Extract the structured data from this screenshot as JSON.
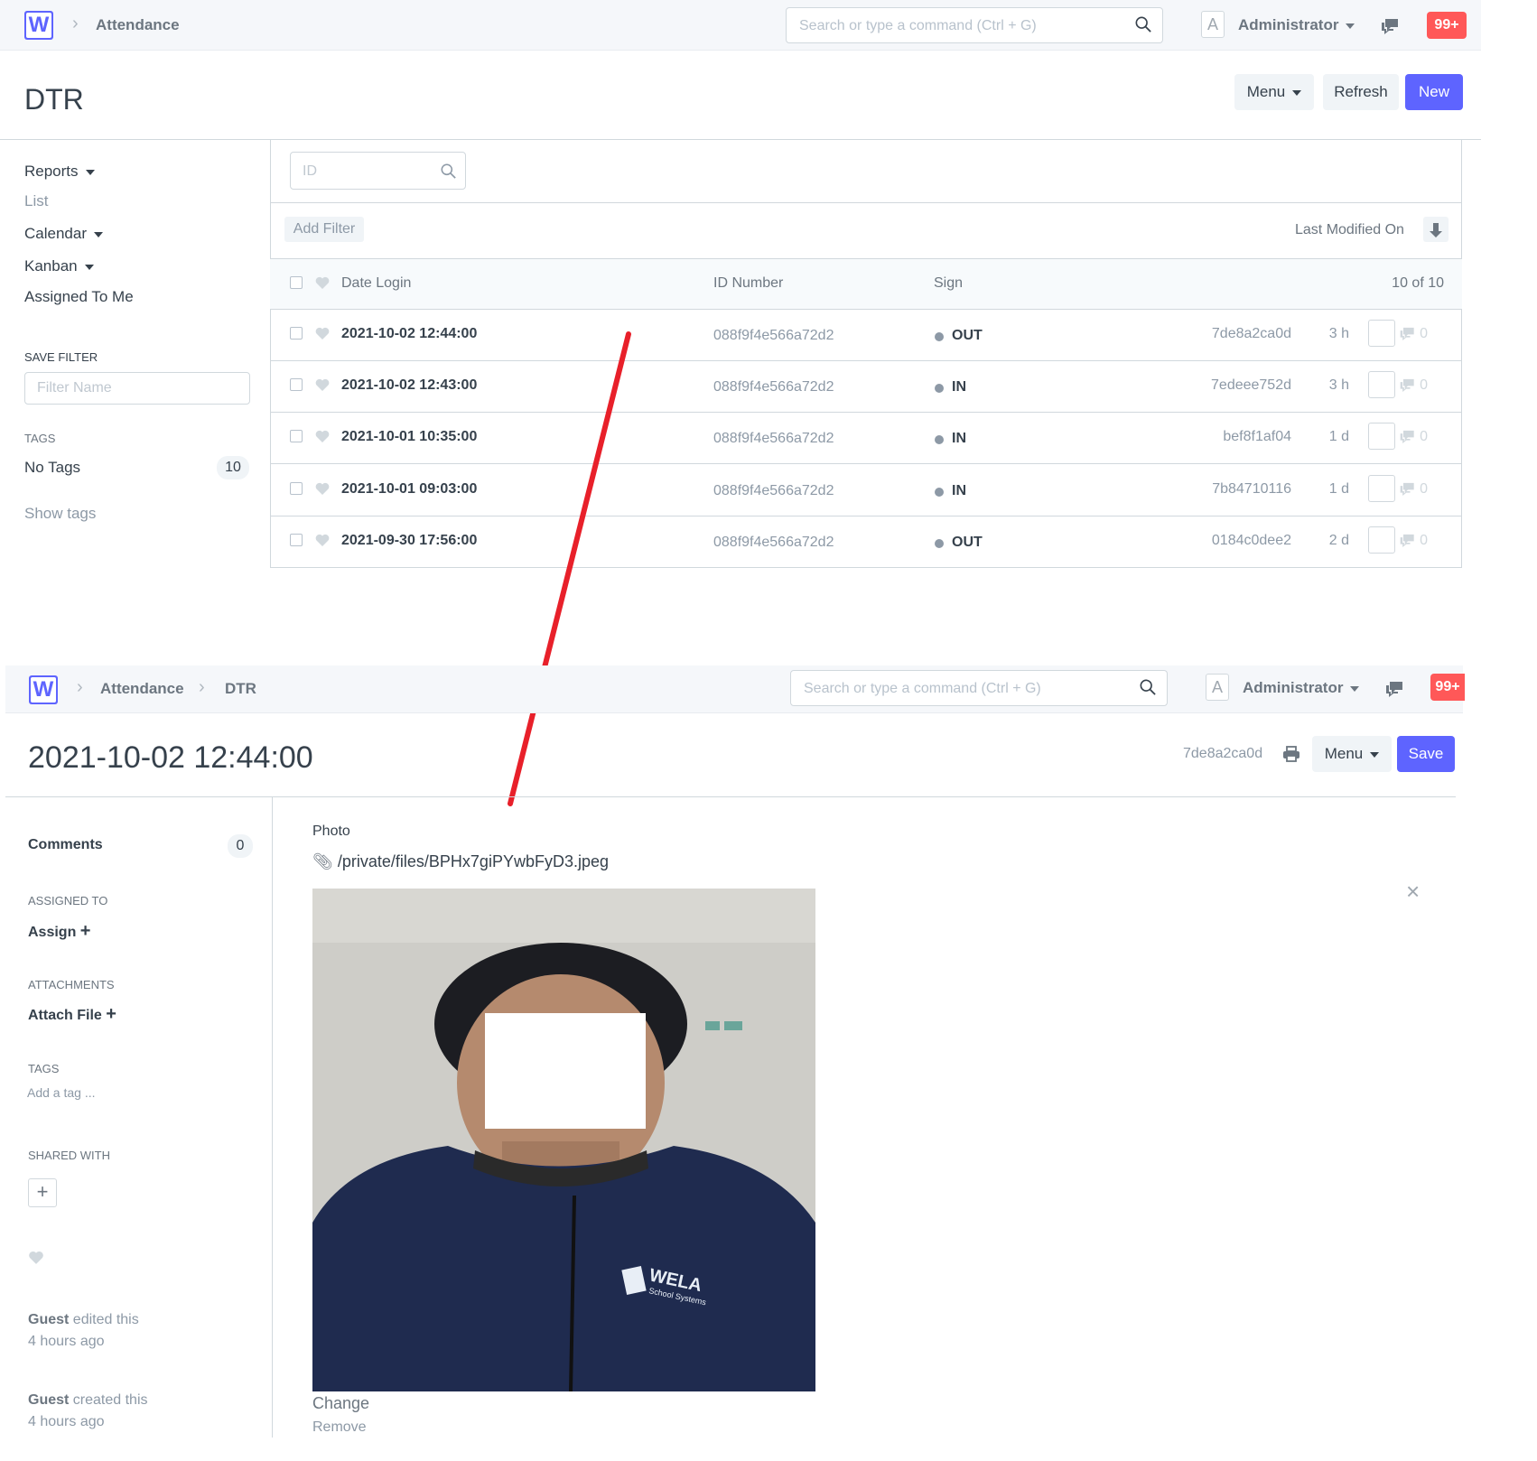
{
  "top": {
    "logo_letter": "W",
    "breadcrumbs": [
      "Attendance"
    ],
    "search_placeholder": "Search or type a command (Ctrl + G)",
    "avatar_letter": "A",
    "user": "Administrator",
    "notif_badge": "99+",
    "page_title": "DTR",
    "buttons": {
      "menu": "Menu",
      "refresh": "Refresh",
      "new": "New"
    },
    "sidebar": {
      "items": [
        "Reports",
        "List",
        "Calendar",
        "Kanban",
        "Assigned To Me"
      ],
      "save_filter_label": "SAVE FILTER",
      "filter_name_placeholder": "Filter Name",
      "tags_label": "TAGS",
      "no_tags": "No Tags",
      "no_tags_count": "10",
      "show_tags": "Show tags"
    },
    "list": {
      "id_placeholder": "ID",
      "add_filter": "Add Filter",
      "sort_label": "Last Modified On",
      "columns": [
        "Date Login",
        "ID Number",
        "Sign"
      ],
      "count": "10 of 10",
      "rows": [
        {
          "date": "2021-10-02 12:44:00",
          "id_number": "088f9f4e566a72d2",
          "sign": "OUT",
          "name": "7de8a2ca0d",
          "age": "3 h",
          "comments": "0"
        },
        {
          "date": "2021-10-02 12:43:00",
          "id_number": "088f9f4e566a72d2",
          "sign": "IN",
          "name": "7edeee752d",
          "age": "3 h",
          "comments": "0"
        },
        {
          "date": "2021-10-01 10:35:00",
          "id_number": "088f9f4e566a72d2",
          "sign": "IN",
          "name": "bef8f1af04",
          "age": "1 d",
          "comments": "0"
        },
        {
          "date": "2021-10-01 09:03:00",
          "id_number": "088f9f4e566a72d2",
          "sign": "IN",
          "name": "7b84710116",
          "age": "1 d",
          "comments": "0"
        },
        {
          "date": "2021-09-30 17:56:00",
          "id_number": "088f9f4e566a72d2",
          "sign": "OUT",
          "name": "0184c0dee2",
          "age": "2 d",
          "comments": "0"
        }
      ]
    }
  },
  "bottom": {
    "logo_letter": "W",
    "breadcrumbs": [
      "Attendance",
      "DTR"
    ],
    "search_placeholder": "Search or type a command (Ctrl + G)",
    "avatar_letter": "A",
    "user": "Administrator",
    "notif_badge": "99+",
    "form_title": "2021-10-02 12:44:00",
    "doc_name": "7de8a2ca0d",
    "buttons": {
      "menu": "Menu",
      "save": "Save"
    },
    "sidebar": {
      "comments": "Comments",
      "comments_count": "0",
      "assigned_to": "ASSIGNED TO",
      "assign": "Assign",
      "attachments": "ATTACHMENTS",
      "attach_file": "Attach File",
      "tags": "TAGS",
      "add_tag": "Add a tag ...",
      "shared_with": "SHARED WITH",
      "activity": [
        {
          "who": "Guest",
          "what": "edited this",
          "when": "4 hours ago"
        },
        {
          "who": "Guest",
          "what": "created this",
          "when": "4 hours ago"
        }
      ]
    },
    "photo_field": {
      "label": "Photo",
      "file_path": "/private/files/BPHx7giPYwbFyD3.jpeg",
      "change": "Change",
      "remove": "Remove",
      "jacket_text": "WELA",
      "jacket_subtext": "School Systems"
    }
  },
  "colors": {
    "primary": "#5e64ff",
    "badge": "#ff5858",
    "annotation": "#e8202a"
  },
  "icons": [
    "search-icon",
    "chat-icon",
    "heart-icon",
    "sort-down-icon",
    "printer-icon",
    "paperclip-icon",
    "close-icon",
    "plus-icon",
    "caret-down-icon",
    "chevron-right-icon"
  ]
}
